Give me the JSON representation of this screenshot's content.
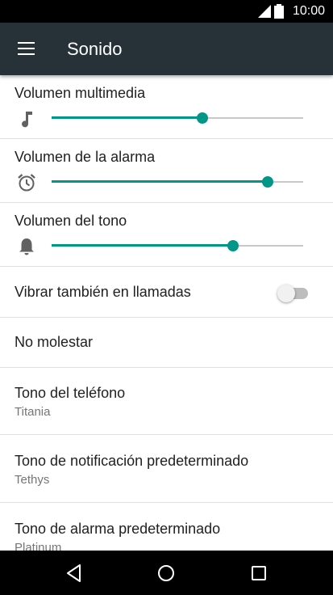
{
  "status_bar": {
    "time": "10:00"
  },
  "app_bar": {
    "title": "Sonido"
  },
  "volumes": [
    {
      "label": "Volumen multimedia",
      "icon": "music-note-icon",
      "level": 0.6
    },
    {
      "label": "Volumen de la alarma",
      "icon": "alarm-clock-icon",
      "level": 0.86
    },
    {
      "label": "Volumen del tono",
      "icon": "bell-icon",
      "level": 0.72
    }
  ],
  "vibrate": {
    "label": "Vibrar también en llamadas",
    "enabled": false
  },
  "dnd": {
    "label": "No molestar"
  },
  "ringtone": {
    "label": "Tono del teléfono",
    "value": "Titania"
  },
  "notification_tone": {
    "label": "Tono de notificación predeterminado",
    "value": "Tethys"
  },
  "alarm_tone": {
    "label": "Tono de alarma predeterminado",
    "value": "Platinum"
  },
  "colors": {
    "accent": "#009688",
    "app_bar": "#263238",
    "status_bar": "#000000"
  }
}
